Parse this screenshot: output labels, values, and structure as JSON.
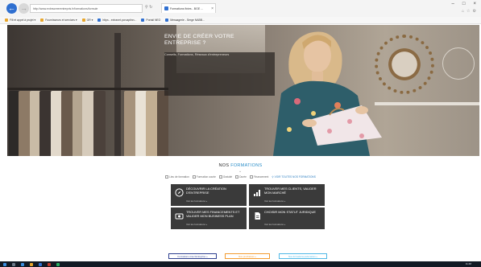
{
  "browser": {
    "address": "http://www.exbrscreerentrepris.fr/formations/formule",
    "tab_title": "Formations finies - BGE ...",
    "tab_close": "×",
    "win_min": "–",
    "win_max": "□",
    "win_close": "×",
    "favorites": [
      {
        "label": "Fill et appel à projet ▾",
        "color": "#e8a62c"
      },
      {
        "label": "Fournisseurs et services ▾",
        "color": "#e8a62c"
      },
      {
        "label": "GR ▾",
        "color": "#e8a62c"
      },
      {
        "label": "https - extranet.pcrcaptinn...",
        "color": "#2f6fd0"
      },
      {
        "label": "Portail NEO",
        "color": "#2f6fd0"
      },
      {
        "label": "Messagerie - Serge NABB...",
        "color": "#2f6fd0"
      }
    ]
  },
  "hero": {
    "title": "ENVIE DE CRÉER VOTRE ENTREPRISE ?",
    "subtitle": "Conseils, Formations, Réseaux d'entrepreneurs"
  },
  "formations": {
    "title_prefix": "NOS",
    "title_accent": "FORMATIONS",
    "chevron": "⌄",
    "filters": [
      "Lieu de formation",
      "Formation courte",
      "Gratuité",
      "Durée",
      "Financement",
      "VOIR TOUTES NOS FORMATIONS"
    ],
    "cards": [
      {
        "title": "DÉCOUVRIR LA CRÉATION D'ENTREPRISE",
        "link": "Voir les formations »",
        "icon": "compass-icon"
      },
      {
        "title": "TROUVER MES CLIENTS, VALIDER MON MARCHÉ",
        "link": "Voir les formations »",
        "icon": "chart-icon"
      },
      {
        "title": "TROUVER MES FINANCEMENTS ET VALIDER MON BUSINESS PLAN",
        "link": "Voir les formations »",
        "icon": "money-icon"
      },
      {
        "title": "CHOISIR MON STATUT JURIDIQUE",
        "link": "Voir les formations »",
        "icon": "document-icon"
      }
    ],
    "buttons": [
      {
        "label": "Formations créer Entreprise »",
        "color": "#2d3f8f"
      },
      {
        "label": "Nos prochaines »",
        "color": "#f39a2e"
      },
      {
        "label": "Nos formations partenaires »",
        "color": "#4fb8e6"
      }
    ]
  },
  "taskbar": {
    "clock": "11:48"
  }
}
